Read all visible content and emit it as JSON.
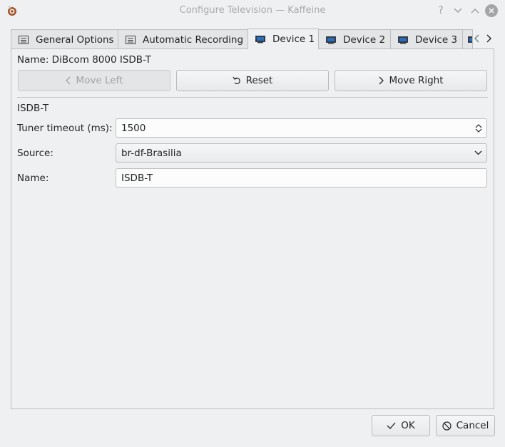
{
  "window": {
    "title": "Configure Television — Kaffeine"
  },
  "tabs": [
    {
      "label": "General Options",
      "active": false
    },
    {
      "label": "Automatic Recording",
      "active": false
    },
    {
      "label": "Device 1",
      "active": true
    },
    {
      "label": "Device 2",
      "active": false
    },
    {
      "label": "Device 3",
      "active": false
    }
  ],
  "device": {
    "name_line": "Name: DiBcom 8000 ISDB-T",
    "move_left_label": "Move Left",
    "reset_label": "Reset",
    "move_right_label": "Move Right"
  },
  "section": {
    "title": "ISDB-T",
    "tuner_timeout_label": "Tuner timeout (ms):",
    "tuner_timeout_value": "1500",
    "source_label": "Source:",
    "source_value": "br-df-Brasilia",
    "name_label": "Name:",
    "name_value": "ISDB-T"
  },
  "dialog_buttons": {
    "ok_label": "OK",
    "cancel_label": "Cancel"
  },
  "colors": {
    "background": "#eff0f1",
    "title_text": "#a8abad",
    "tv_icon_screen": "#2a6fbf"
  }
}
